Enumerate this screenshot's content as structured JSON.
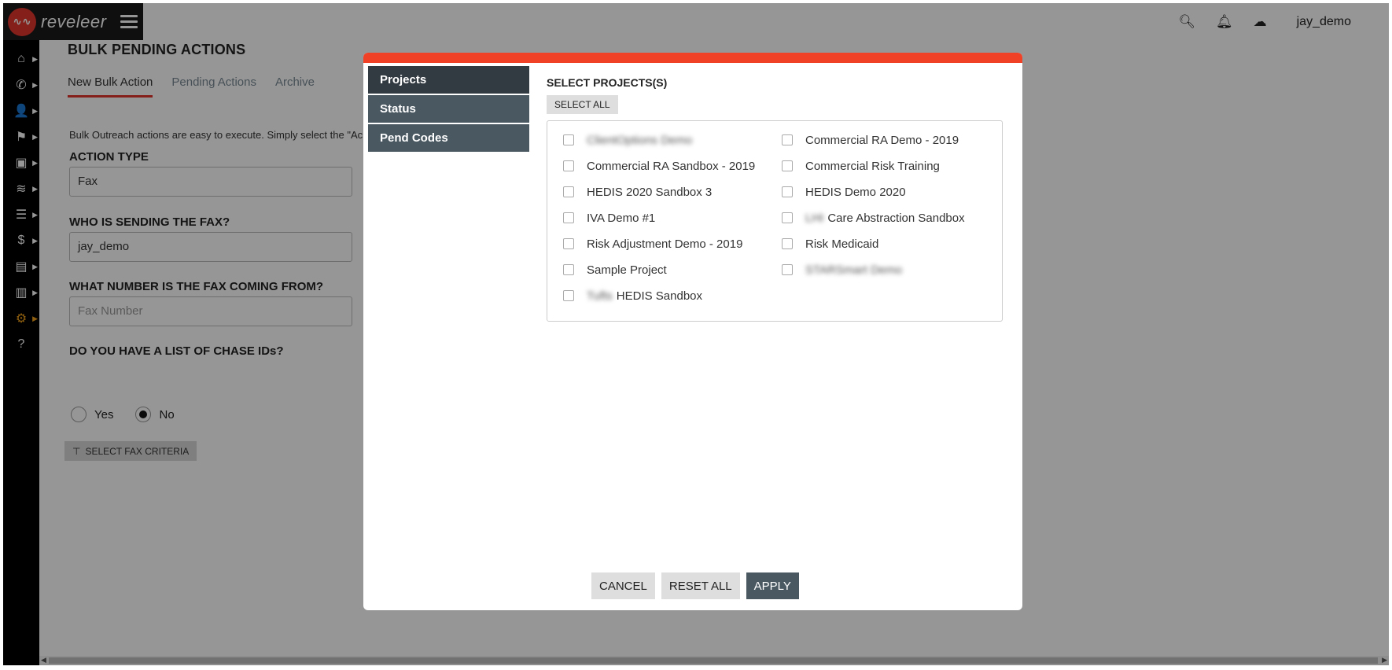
{
  "app": {
    "logo_text": "reveleer",
    "logo_mark": "∿∿"
  },
  "topbar": {
    "username": "jay_demo"
  },
  "sidebar": {
    "items": [
      {
        "name": "home-icon",
        "glyph": "⌂"
      },
      {
        "name": "phone-icon",
        "glyph": "✆"
      },
      {
        "name": "users-icon",
        "glyph": "👤"
      },
      {
        "name": "flag-icon",
        "glyph": "⚑"
      },
      {
        "name": "briefcase-icon",
        "glyph": "▣"
      },
      {
        "name": "layers-icon",
        "glyph": "≋"
      },
      {
        "name": "tasks-icon",
        "glyph": "☰"
      },
      {
        "name": "dollar-icon",
        "glyph": "$"
      },
      {
        "name": "clipboard-icon",
        "glyph": "▤"
      },
      {
        "name": "chart-icon",
        "glyph": "▥"
      },
      {
        "name": "gear-icon",
        "glyph": "⚙"
      },
      {
        "name": "help-icon",
        "glyph": "?"
      }
    ]
  },
  "page": {
    "title": "BULK PENDING ACTIONS",
    "tabs": [
      "New Bulk Action",
      "Pending Actions",
      "Archive"
    ],
    "intro": "Bulk Outreach actions are easy to execute. Simply select the \"Ac",
    "action_type_label": "ACTION TYPE",
    "action_type_value": "Fax",
    "sender_label": "WHO IS SENDING THE FAX?",
    "sender_value": "jay_demo",
    "number_label": "WHAT NUMBER IS THE FAX COMING FROM?",
    "number_placeholder": "Fax Number",
    "chase_label": "DO YOU HAVE A LIST OF CHASE IDs?",
    "radio_yes": "Yes",
    "radio_no": "No",
    "radio_selected": "No",
    "criteria_button": "SELECT FAX CRITERIA"
  },
  "modal": {
    "nav": [
      "Projects",
      "Status",
      "Pend Codes"
    ],
    "active_nav": "Projects",
    "title": "SELECT PROJECTS(S)",
    "select_all": "SELECT ALL",
    "projects": [
      {
        "label": "ClientOptions Demo",
        "blurred": true
      },
      {
        "label": "Commercial RA Demo - 2019",
        "blurred": false
      },
      {
        "label": "Commercial RA Sandbox - 2019",
        "blurred": false
      },
      {
        "label": "Commercial Risk Training",
        "blurred": false
      },
      {
        "label": "HEDIS 2020 Sandbox 3",
        "blurred": false
      },
      {
        "label": "HEDIS Demo 2020",
        "blurred": false
      },
      {
        "label": "IVA Demo #1",
        "blurred": false
      },
      {
        "label": "Care Abstraction Sandbox",
        "prefix_blurred": "LHI",
        "blurred": false
      },
      {
        "label": "Risk Adjustment Demo - 2019",
        "blurred": false
      },
      {
        "label": "Risk Medicaid",
        "blurred": false
      },
      {
        "label": "Sample Project",
        "blurred": false
      },
      {
        "label": "STARSmart Demo",
        "blurred": true
      },
      {
        "label": "HEDIS Sandbox",
        "prefix_blurred": "Tufts",
        "blurred": false
      }
    ],
    "buttons": {
      "cancel": "CANCEL",
      "reset": "RESET ALL",
      "apply": "APPLY"
    }
  }
}
